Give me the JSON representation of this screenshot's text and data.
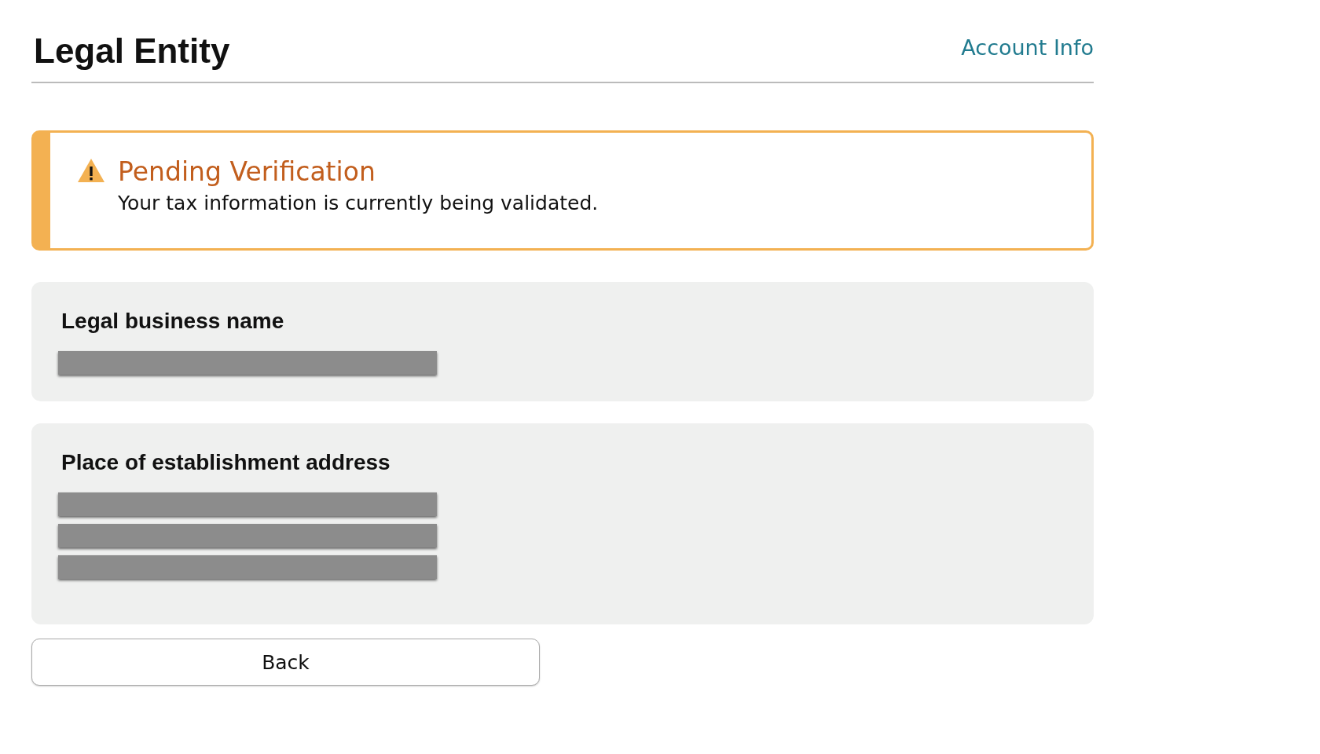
{
  "header": {
    "title": "Legal Entity",
    "link": "Account Info"
  },
  "alert": {
    "kind": "warning",
    "title": "Pending Verification",
    "message": "Your tax information is currently being validated."
  },
  "sections": [
    {
      "label": "Legal business name",
      "value_lines": [
        {
          "kind": "redacted"
        }
      ]
    },
    {
      "label": "Place of establishment address",
      "value_lines": [
        {
          "kind": "redacted"
        },
        {
          "kind": "redacted"
        },
        {
          "kind": "redacted"
        }
      ]
    }
  ],
  "buttons": [
    "Back"
  ]
}
